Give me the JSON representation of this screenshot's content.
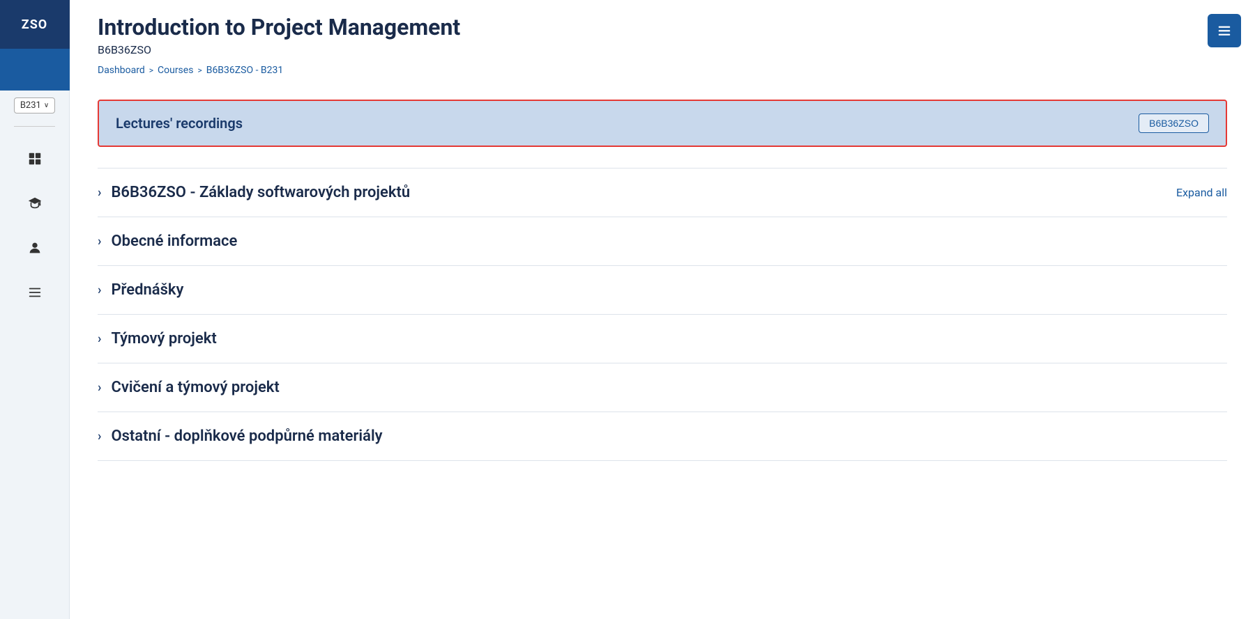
{
  "sidebar": {
    "logo_text": "ZSO",
    "version": "B231",
    "version_chevron": "∨",
    "nav_items": [
      {
        "name": "grid-icon",
        "label": "Grid"
      },
      {
        "name": "graduation-icon",
        "label": "Courses"
      },
      {
        "name": "user-icon",
        "label": "Profile"
      },
      {
        "name": "menu-lines-icon",
        "label": "Menu"
      }
    ]
  },
  "header": {
    "title": "Introduction to Project Management",
    "course_code": "B6B36ZSO",
    "breadcrumb": {
      "items": [
        "Dashboard",
        "Courses",
        "B6B36ZSO - B231"
      ],
      "separators": [
        ">",
        ">"
      ]
    }
  },
  "recordings_banner": {
    "title": "Lectures' recordings",
    "badge_label": "B6B36ZSO"
  },
  "sections": [
    {
      "label": "B6B36ZSO - Základy softwarových projektů",
      "show_expand_all": true,
      "expand_all_label": "Expand all"
    },
    {
      "label": "Obecné informace",
      "show_expand_all": false
    },
    {
      "label": "Přednášky",
      "show_expand_all": false
    },
    {
      "label": "Týmový projekt",
      "show_expand_all": false
    },
    {
      "label": "Cvičení a týmový projekt",
      "show_expand_all": false
    },
    {
      "label": "Ostatní - doplňkové podpůrné materiály",
      "show_expand_all": false
    }
  ],
  "top_right_button": {
    "icon": "≡"
  },
  "menu_button": {
    "icon": "≡"
  }
}
